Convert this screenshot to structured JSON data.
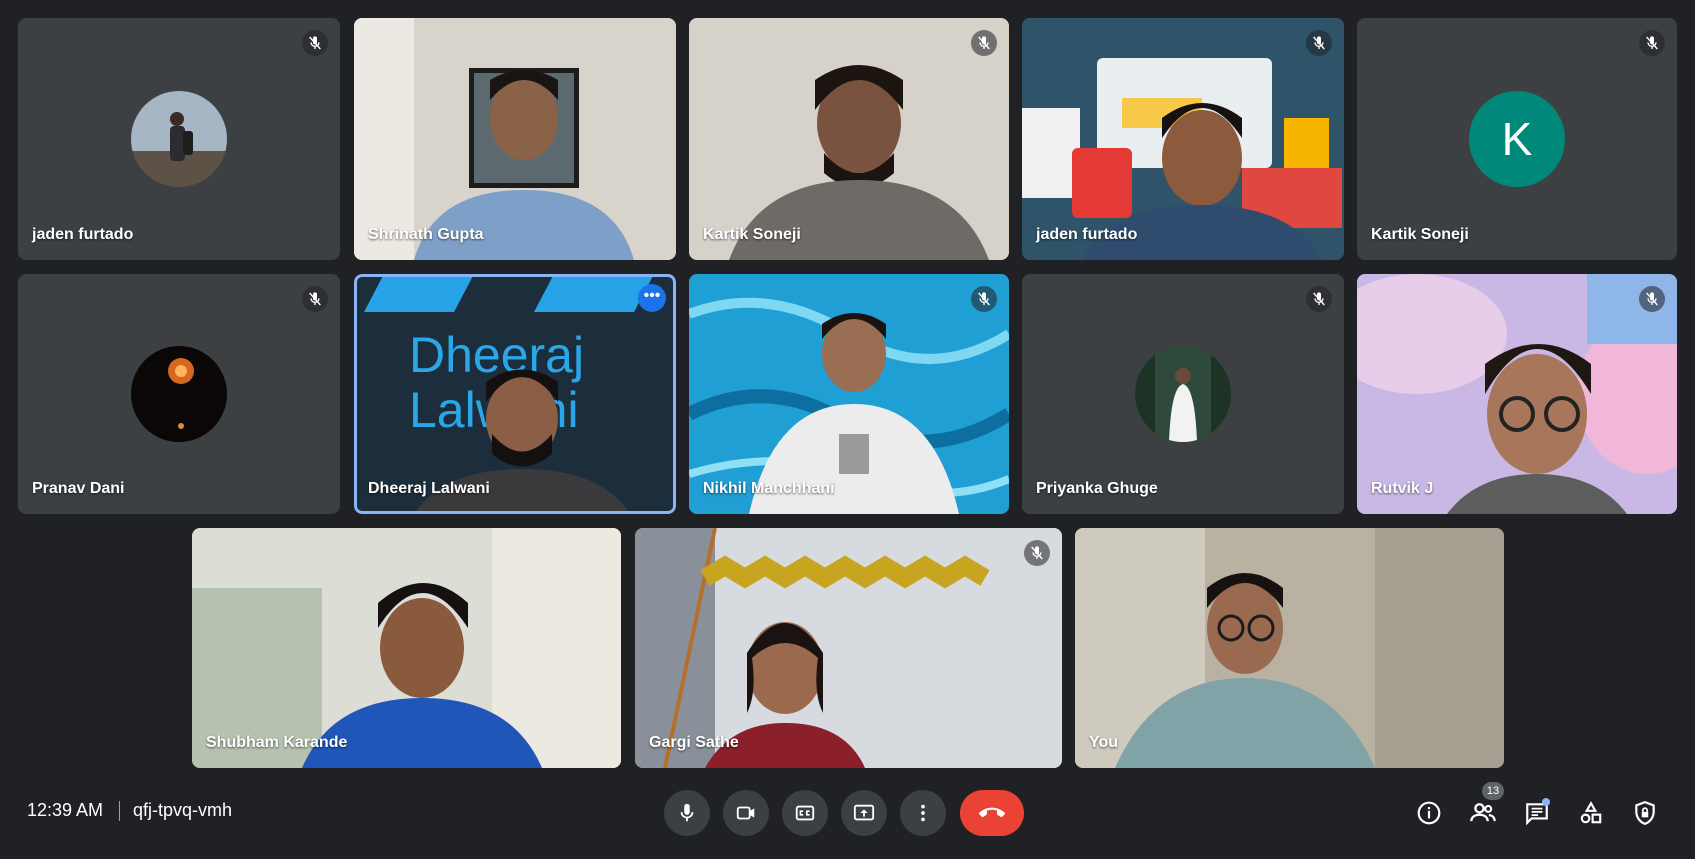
{
  "participants": [
    {
      "name": "jaden furtado"
    },
    {
      "name": "Shrinath Gupta"
    },
    {
      "name": "Kartik Soneji"
    },
    {
      "name": "jaden furtado"
    },
    {
      "name": "Kartik Soneji",
      "avatar_letter": "K"
    },
    {
      "name": "Pranav Dani"
    },
    {
      "name": "Dheeraj Lalwani",
      "background_text_line1": "Dheeraj",
      "background_text_line2": "Lalwani"
    },
    {
      "name": "Nikhil Manchhani"
    },
    {
      "name": "Priyanka Ghuge"
    },
    {
      "name": "Rutvik J"
    },
    {
      "name": "Shubham Karande"
    },
    {
      "name": "Gargi Sathe"
    },
    {
      "name": "You"
    }
  ],
  "tile_menu_glyph": "•••",
  "meeting": {
    "time": "12:39 AM",
    "code": "qfj-tpvq-vmh"
  },
  "people_count": "13",
  "icons": {
    "mute": "mic-off-icon",
    "mic": "mic-icon",
    "camera": "videocam-icon",
    "captions": "closed-caption-icon",
    "present": "present-screen-icon",
    "more": "more-vert-icon",
    "end": "call-end-icon",
    "info": "info-icon",
    "people": "people-icon",
    "chat": "chat-icon",
    "activities": "activities-icon",
    "host": "host-controls-icon"
  },
  "colors": {
    "background": "#202124",
    "tile": "#3c4043",
    "active_speaker": "#8ab4f8",
    "end_call": "#ea4335",
    "avatar_k": "#00897b"
  }
}
